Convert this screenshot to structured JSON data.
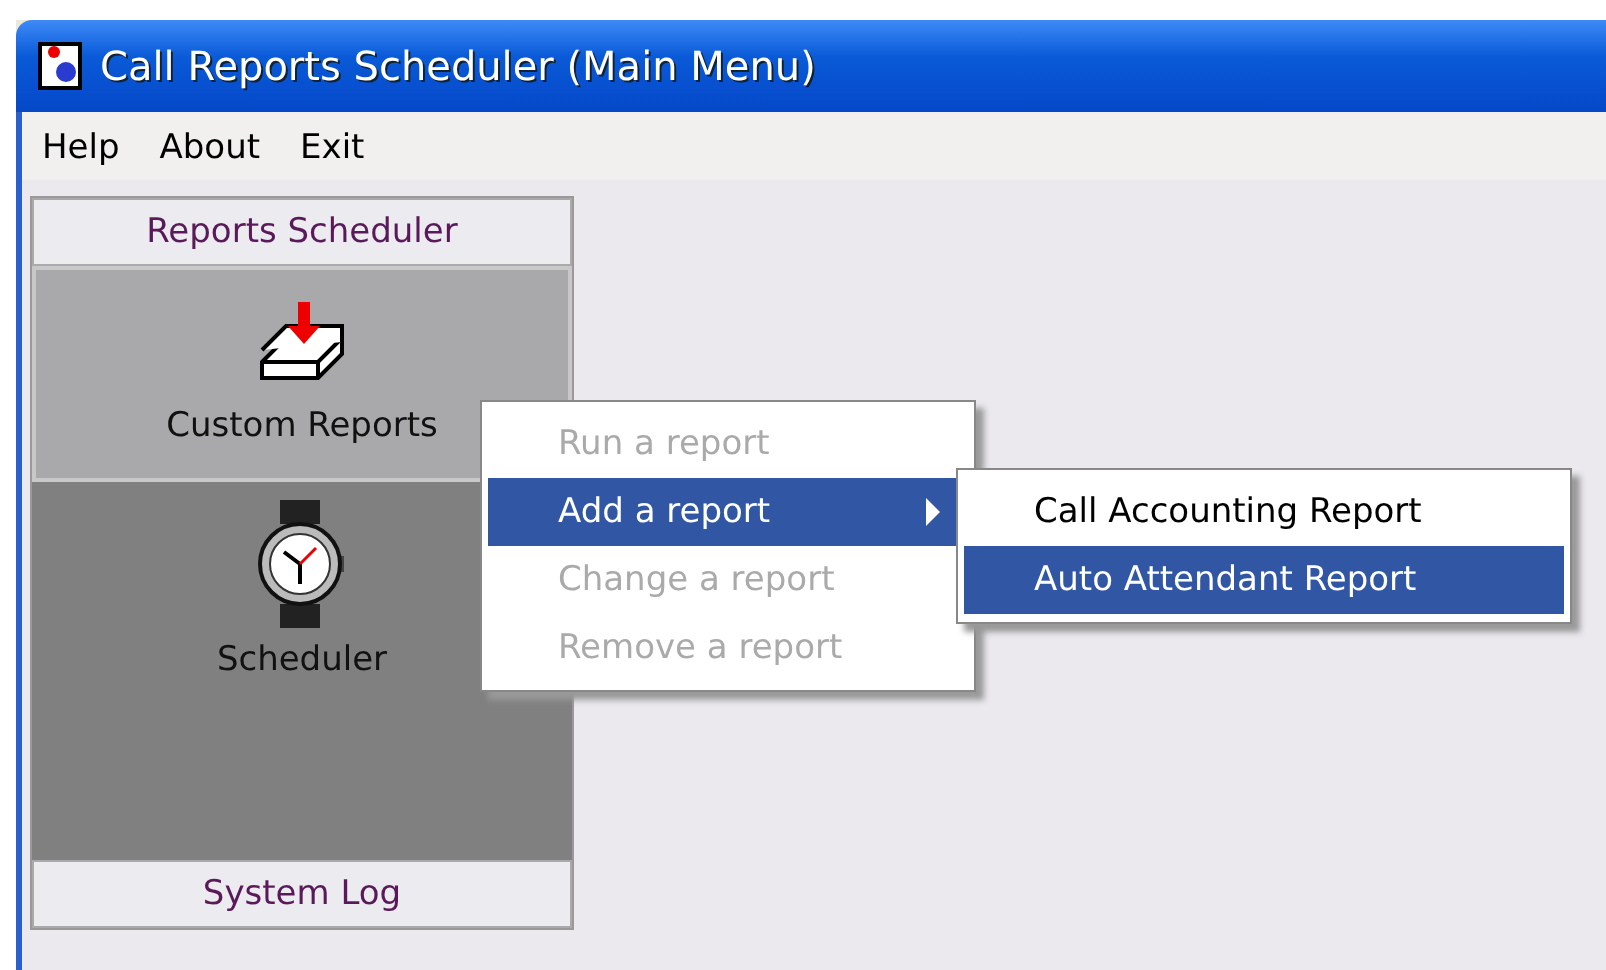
{
  "window": {
    "title": "Call Reports Scheduler (Main Menu)"
  },
  "menu_bar": [
    {
      "label": "Help"
    },
    {
      "label": "About"
    },
    {
      "label": "Exit"
    }
  ],
  "sidebar": {
    "header": "Reports Scheduler",
    "items": [
      {
        "label": "Custom Reports",
        "selected": true
      },
      {
        "label": "Scheduler",
        "selected": false
      }
    ],
    "footer": "System Log"
  },
  "context_menu": [
    {
      "label": "Run a report",
      "disabled": true,
      "highlighted": false,
      "submenu": false
    },
    {
      "label": "Add a report",
      "disabled": false,
      "highlighted": true,
      "submenu": true
    },
    {
      "label": "Change a report",
      "disabled": true,
      "highlighted": false,
      "submenu": false
    },
    {
      "label": "Remove a report",
      "disabled": true,
      "highlighted": false,
      "submenu": false
    }
  ],
  "submenu": [
    {
      "label": "Call Accounting Report",
      "highlighted": false
    },
    {
      "label": "Auto Attendant Report",
      "highlighted": true
    }
  ]
}
